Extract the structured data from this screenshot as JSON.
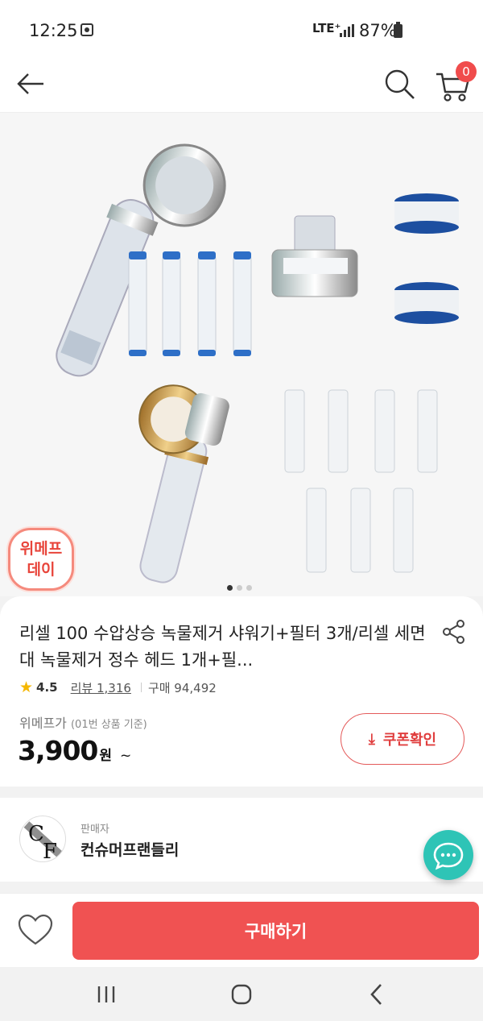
{
  "status_bar": {
    "time": "12:25",
    "network": "LTE⁺",
    "battery": "87%"
  },
  "nav": {
    "cart_count": "0"
  },
  "product": {
    "event_badge_line1": "위메프",
    "event_badge_line2": "데이",
    "title": "리셀 100 수압상승 녹물제거 샤워기+필터 3개/리셀 세면대 녹물제거 정수 헤드 1개+필...",
    "rating": "4.5",
    "reviews": "리뷰 1,316",
    "purchases": "구매 94,492",
    "price_label": "위메프가",
    "price_note": "(01번 상품 기준)",
    "price": "3,900",
    "price_unit": "원",
    "price_suffix": "~",
    "coupon_label": "쿠폰확인",
    "image_page": 1,
    "image_count": 3
  },
  "seller": {
    "label": "판매자",
    "name": "컨슈머프랜들리",
    "logo_text": "CF"
  },
  "actions": {
    "buy_label": "구매하기"
  },
  "colors": {
    "accent": "#f05252",
    "chat": "#2ec4b6",
    "star": "#f5b700"
  }
}
